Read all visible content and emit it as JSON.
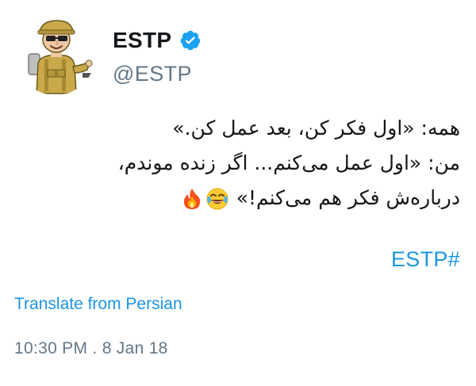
{
  "author": {
    "display_name": "ESTP",
    "handle": "@ESTP",
    "verified": true,
    "avatar_icon": "cartoon-explorer-avatar",
    "verified_icon": "verified-badge-icon"
  },
  "tweet": {
    "lines": [
      "همه: «اول فکر کن، بعد عمل کن.»",
      "من: «اول عمل می‌کنم... اگر زنده موندم،",
      "درباره‌ش فکر هم می‌کنم!»"
    ],
    "emojis": [
      "tears-of-joy-emoji",
      "fire-emoji"
    ],
    "hashtag": "ESTP#"
  },
  "actions": {
    "translate_label": "Translate from Persian"
  },
  "meta": {
    "timestamp": "10:30 PM . 8 Jan 18"
  },
  "colors": {
    "link": "#1b95e0",
    "secondary_text": "#657786",
    "primary_text": "#14171a",
    "verified": "#1da1f2"
  }
}
